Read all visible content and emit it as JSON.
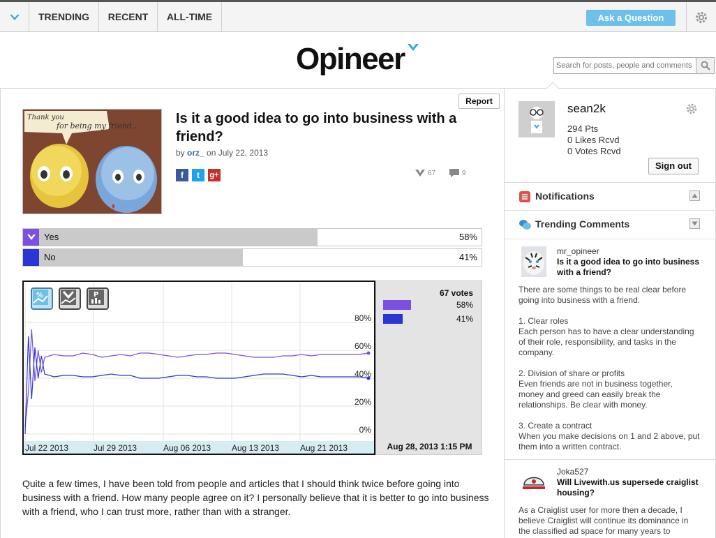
{
  "nav": {
    "tabs": [
      {
        "label": "TRENDING"
      },
      {
        "label": "RECENT"
      },
      {
        "label": "ALL-TIME"
      }
    ],
    "ask_label": "Ask a Question"
  },
  "brand": {
    "name": "Opineer"
  },
  "search": {
    "placeholder": "Search for posts, people and comments"
  },
  "post": {
    "report_label": "Report",
    "title": "Is it a good idea to go into business with a friend?",
    "by": "by ",
    "author": "orz_",
    "date": " on July 22, 2013",
    "votes_count": "67",
    "comments_count": "9",
    "thumb_caption_1": "Thank you",
    "thumb_caption_2": "for being my friend...",
    "options": [
      {
        "label": "Yes",
        "percent": "58%",
        "value": 0.58
      },
      {
        "label": "No",
        "percent": "41%",
        "value": 0.41
      }
    ],
    "body": "Quite a few times, I have been told from people and articles that I should think twice before going into business with a friend. How many people agree on it? I personally believe that it is better to go into business with a friend, who I can trust more, rather than with a stranger."
  },
  "chart_data": {
    "type": "line",
    "x_labels": [
      "Jul 22 2013",
      "Jul 29 2013",
      "Aug 06 2013",
      "Aug 13 2013",
      "Aug 21 2013"
    ],
    "y_labels": [
      "80%",
      "60%",
      "40%",
      "20%",
      "0%"
    ],
    "ylim": [
      0,
      100
    ],
    "series": [
      {
        "name": "Yes",
        "color": "#7b4fe0",
        "values": [
          55,
          57,
          56,
          56,
          58,
          57,
          55,
          56,
          57,
          56,
          58,
          58,
          57,
          56,
          55,
          56,
          57,
          57,
          58,
          58,
          57,
          56,
          55,
          55,
          55,
          56,
          56,
          57,
          56,
          57,
          57,
          57,
          57,
          57,
          58
        ]
      },
      {
        "name": "No",
        "color": "#2a35d4",
        "values": [
          43,
          41,
          42,
          42,
          41,
          41,
          42,
          43,
          42,
          42,
          40,
          40,
          40,
          41,
          42,
          42,
          41,
          41,
          40,
          40,
          40,
          41,
          42,
          43,
          43,
          43,
          42,
          41,
          42,
          41,
          41,
          41,
          41,
          41,
          40
        ]
      }
    ],
    "summary": {
      "votes": "67 votes",
      "date": "Aug 28, 2013 1:15 PM",
      "percents": [
        "58%",
        "41%"
      ]
    }
  },
  "user": {
    "name": "sean2k",
    "points": "294  Pts",
    "likes": "0  Likes Rcvd",
    "votes": "0  Votes Rcvd",
    "signout_label": "Sign out"
  },
  "sidebar": {
    "notifications_label": "Notifications",
    "trending_label": "Trending Comments",
    "comments": [
      {
        "user": "mr_opineer",
        "title": "Is it a good idea to go into business with a friend?",
        "body": "There are some things to be real clear before going into business with a friend.\n\n1. Clear roles\nEach person has to have a clear understanding of their role, responsibility, and tasks in the company.\n\n2. Division of share or profits\nEven friends are not in business together, money and greed can easily break the relationships. Be clear with money.\n\n3. Create a contract\nWhen you make decisions on 1 and 2 above, put them into a written contract."
      },
      {
        "user": "Joka527",
        "title": "Will Livewith.us supersede craiglist housing?",
        "body": "As a Craiglist user for more then a decade, I believe Craiglist will continue its dominance in the classified ad space for many years to"
      }
    ]
  }
}
